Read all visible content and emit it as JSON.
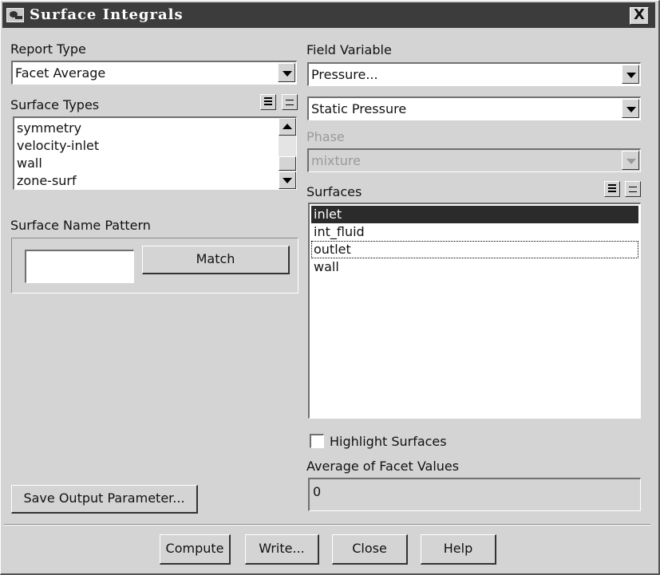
{
  "window": {
    "title": "Surface Integrals",
    "close_label": "X"
  },
  "report_type": {
    "label": "Report Type",
    "selected": "Facet Average"
  },
  "surface_types": {
    "label": "Surface Types",
    "items": [
      "symmetry",
      "velocity-inlet",
      "wall",
      "zone-surf"
    ]
  },
  "surface_name_pattern": {
    "label": "Surface Name Pattern",
    "value": "",
    "match_label": "Match"
  },
  "field_variable": {
    "label": "Field Variable",
    "category": "Pressure...",
    "variable": "Static Pressure"
  },
  "phase": {
    "label": "Phase",
    "selected": "mixture",
    "enabled": false
  },
  "surfaces": {
    "label": "Surfaces",
    "items": [
      {
        "name": "inlet",
        "selected": true
      },
      {
        "name": "int_fluid",
        "selected": false
      },
      {
        "name": "outlet",
        "selected": false,
        "focused": true
      },
      {
        "name": "wall",
        "selected": false
      }
    ]
  },
  "highlight_surfaces": {
    "label": "Highlight Surfaces",
    "checked": false
  },
  "result": {
    "label": "Average of Facet Values",
    "value": "0"
  },
  "buttons": {
    "save_output": "Save Output Parameter...",
    "compute": "Compute",
    "write": "Write...",
    "close": "Close",
    "help": "Help"
  }
}
